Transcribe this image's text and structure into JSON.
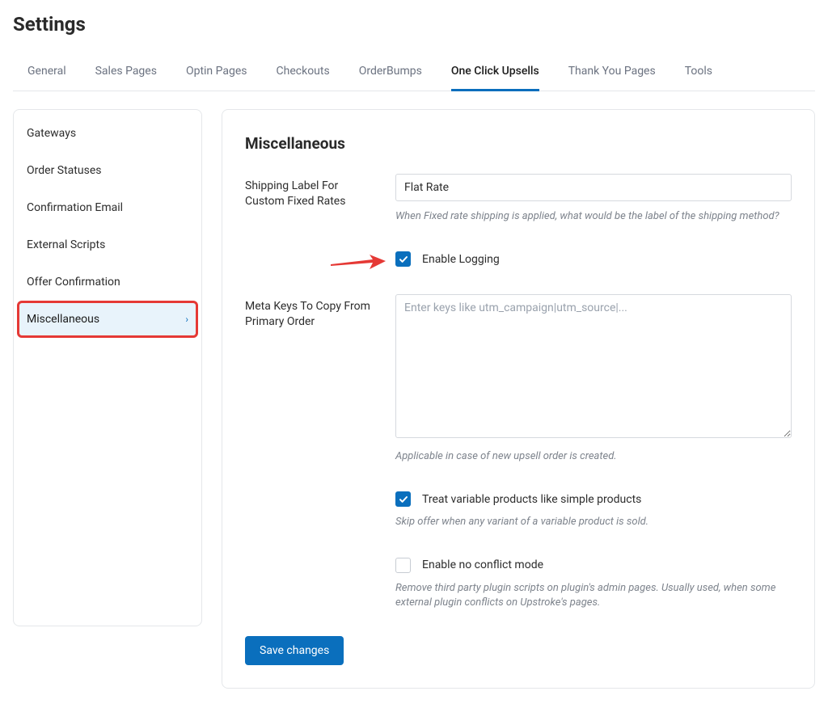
{
  "page_title": "Settings",
  "tabs": [
    {
      "label": "General"
    },
    {
      "label": "Sales Pages"
    },
    {
      "label": "Optin Pages"
    },
    {
      "label": "Checkouts"
    },
    {
      "label": "OrderBumps"
    },
    {
      "label": "One Click Upsells"
    },
    {
      "label": "Thank You Pages"
    },
    {
      "label": "Tools"
    }
  ],
  "active_tab_index": 5,
  "sidebar": {
    "items": [
      {
        "label": "Gateways"
      },
      {
        "label": "Order Statuses"
      },
      {
        "label": "Confirmation Email"
      },
      {
        "label": "External Scripts"
      },
      {
        "label": "Offer Confirmation"
      },
      {
        "label": "Miscellaneous"
      }
    ],
    "active_index": 5
  },
  "panel": {
    "title": "Miscellaneous",
    "shipping_label": {
      "label": "Shipping Label For Custom Fixed Rates",
      "value": "Flat Rate",
      "help": "When Fixed rate shipping is applied, what would be the label of the shipping method?"
    },
    "enable_logging": {
      "label": "Enable Logging",
      "checked": true
    },
    "meta_keys": {
      "label": "Meta Keys To Copy From Primary Order",
      "value": "",
      "placeholder": "Enter keys like utm_campaign|utm_source|...",
      "help": "Applicable in case of new upsell order is created."
    },
    "treat_variable": {
      "label": "Treat variable products like simple products",
      "checked": true,
      "help": "Skip offer when any variant of a variable product is sold."
    },
    "no_conflict": {
      "label": "Enable no conflict mode",
      "checked": false,
      "help": "Remove third party plugin scripts on plugin's admin pages. Usually used, when some external plugin conflicts on Upstroke's pages."
    },
    "save_button": "Save changes"
  },
  "highlight_sidebar_index": 5
}
